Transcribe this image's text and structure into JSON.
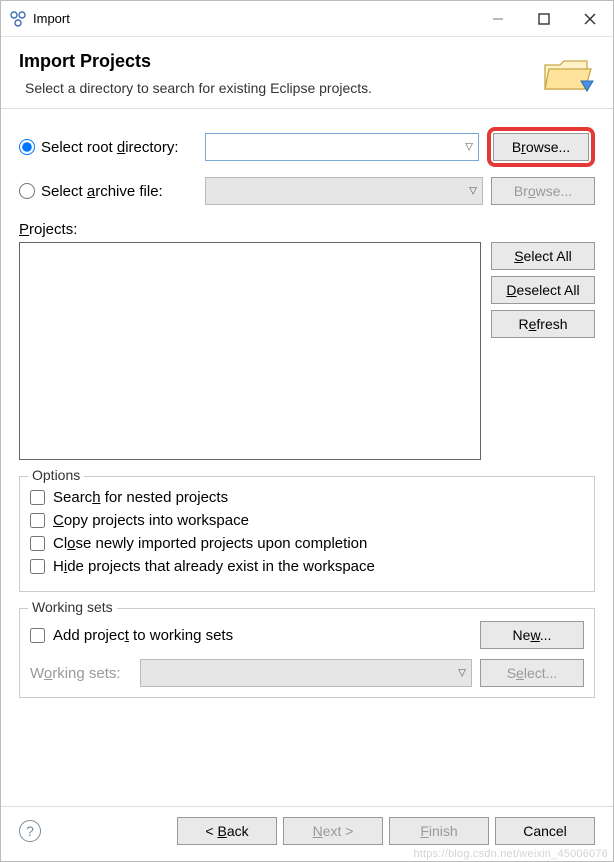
{
  "window": {
    "title": "Import"
  },
  "header": {
    "title": "Import Projects",
    "subtitle": "Select a directory to search for existing Eclipse projects."
  },
  "source": {
    "rootdir_label_pre": "Select root ",
    "rootdir_label_u": "d",
    "rootdir_label_post": "irectory:",
    "rootdir_value": "",
    "archive_label_pre": "Select ",
    "archive_label_u": "a",
    "archive_label_post": "rchive file:",
    "archive_value": "",
    "browse_label_pre": "B",
    "browse_label_u": "r",
    "browse_label_post": "owse...",
    "browse2_label_pre": "Br",
    "browse2_label_u": "o",
    "browse2_label_post": "wse..."
  },
  "projects": {
    "label_u": "P",
    "label_post": "rojects:",
    "select_all_u": "S",
    "select_all_post": "elect All",
    "deselect_all_u": "D",
    "deselect_all_post": "eselect All",
    "refresh_pre": "R",
    "refresh_u": "e",
    "refresh_post": "fresh"
  },
  "options": {
    "title": "Options",
    "nested_pre": "Searc",
    "nested_u": "h",
    "nested_post": " for nested projects",
    "copy_u": "C",
    "copy_post": "opy projects into workspace",
    "close_pre": "Cl",
    "close_u": "o",
    "close_post": "se newly imported projects upon completion",
    "hide_pre": "H",
    "hide_u": "i",
    "hide_post": "de projects that already exist in the workspace"
  },
  "workingsets": {
    "title": "Working sets",
    "add_pre": "Add projec",
    "add_u": "t",
    "add_post": " to working sets",
    "new_pre": "Ne",
    "new_u": "w",
    "new_post": "...",
    "label_pre": "W",
    "label_u": "o",
    "label_post": "rking sets:",
    "value": "",
    "select_pre": "S",
    "select_u": "e",
    "select_post": "lect..."
  },
  "footer": {
    "back_pre": "< ",
    "back_u": "B",
    "back_post": "ack",
    "next_u": "N",
    "next_post": "ext >",
    "finish_u": "F",
    "finish_post": "inish",
    "cancel": "Cancel"
  },
  "watermark": "https://blog.csdn.net/weixin_45006076"
}
